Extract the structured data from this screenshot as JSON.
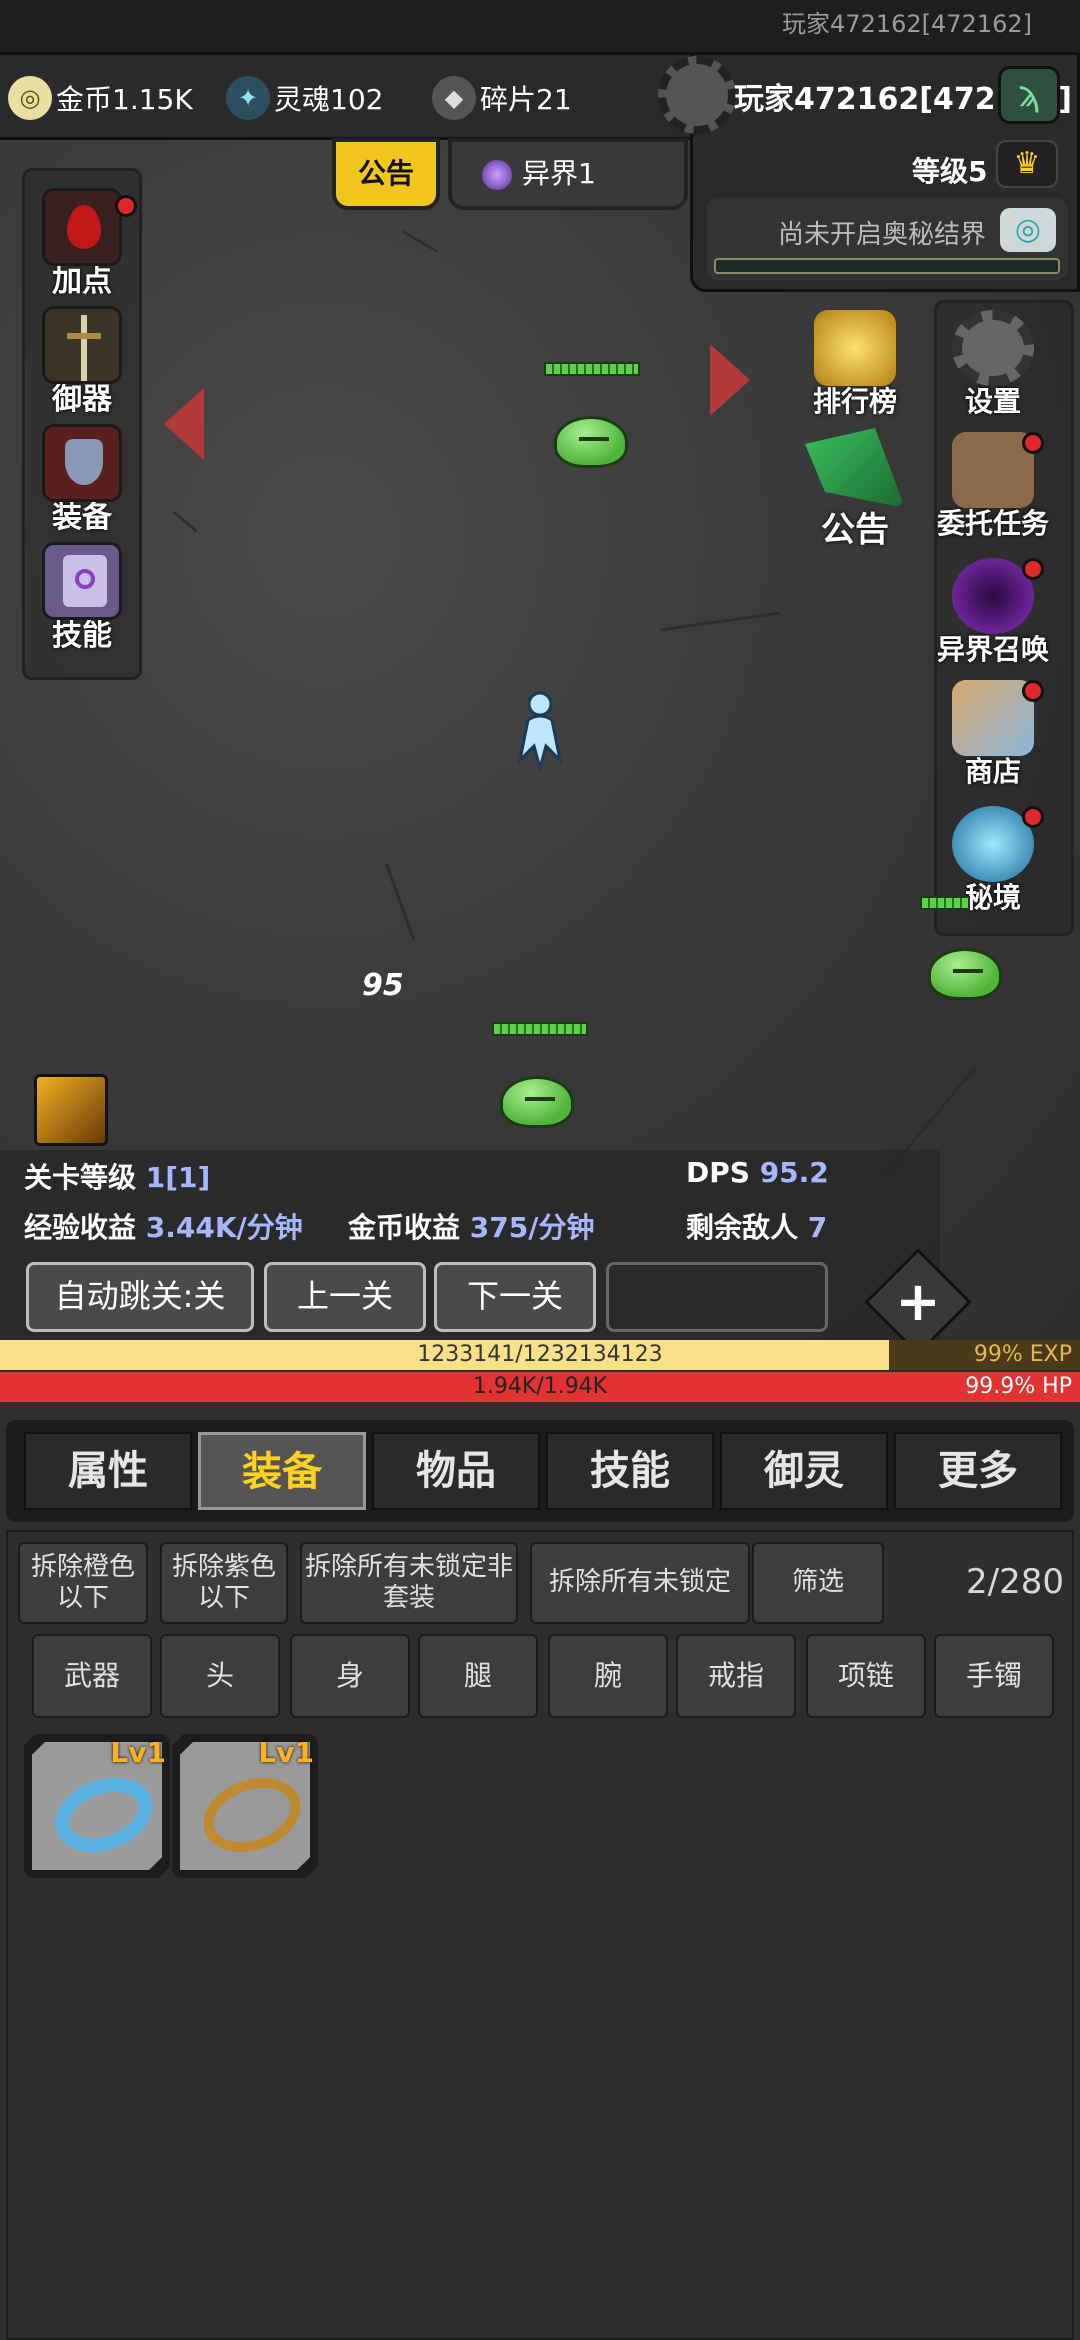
{
  "top_strip": {
    "account": "玩家472162[472162]"
  },
  "resources": {
    "gold": "金币1.15K",
    "soul": "灵魂102",
    "fragment": "碎片21"
  },
  "player": {
    "name": "玩家472162[472162]",
    "level": "等级5",
    "mystic_text": "尚未开启奥秘结界"
  },
  "top_tabs": {
    "notice": "公告",
    "otherworld": "异界1"
  },
  "left_menu": [
    "加点",
    "御器",
    "装备",
    "技能"
  ],
  "right_menu": [
    "排行榜",
    "设置",
    "公告",
    "委托任务",
    "异界召唤",
    "商店",
    "秘境"
  ],
  "battle": {
    "damage": "95"
  },
  "stats": {
    "stage_label": "关卡等级",
    "stage_value": "1[1]",
    "dps_label": "DPS",
    "dps_value": "95.2",
    "exp_label": "经验收益",
    "exp_value": "3.44K/分钟",
    "gold_label": "金币收益",
    "gold_value": "375/分钟",
    "enemies_label": "剩余敌人",
    "enemies_value": "7"
  },
  "controls": {
    "auto": "自动跳关:关",
    "prev": "上一关",
    "next": "下一关",
    "plus": "+"
  },
  "exp_bar": {
    "text": "1233141/1232134123",
    "pct": "99% EXP",
    "fill": 0.823
  },
  "hp_bar": {
    "text": "1.94K/1.94K",
    "pct": "99.9% HP"
  },
  "tabs": [
    "属性",
    "装备",
    "物品",
    "技能",
    "御灵",
    "更多"
  ],
  "active_tab": "装备",
  "actions": {
    "dismantle_orange": "拆除橙色以下",
    "dismantle_purple": "拆除紫色以下",
    "dismantle_unlocked_nonset": "拆除所有未锁定非套装",
    "dismantle_unlocked": "拆除所有未锁定",
    "filter": "筛选",
    "count": "2/280"
  },
  "filters": [
    "武器",
    "头",
    "身",
    "腿",
    "腕",
    "戒指",
    "项链",
    "手镯"
  ],
  "items": [
    {
      "level": "Lv1",
      "color": "#5ab0e0"
    },
    {
      "level": "Lv1",
      "color": "#c08a30"
    }
  ]
}
